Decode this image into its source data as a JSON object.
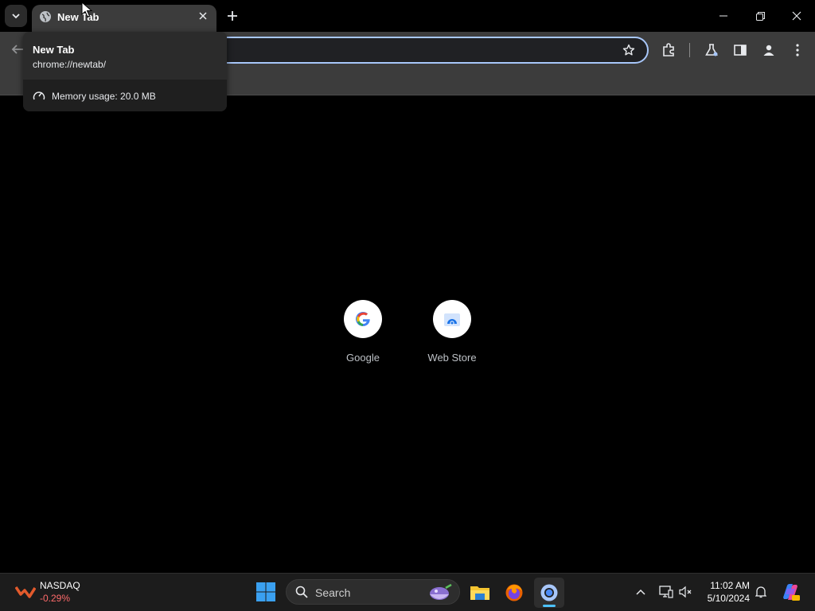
{
  "browser": {
    "tab": {
      "title": "New Tab",
      "favicon": "globe-icon"
    },
    "hovercard": {
      "title": "New Tab",
      "url": "chrome://newtab/",
      "memory": "Memory usage: 20.0 MB"
    },
    "omnibox": {
      "value": ""
    },
    "toolbar_icons": [
      "back-arrow-icon",
      "star-icon",
      "extensions-icon",
      "labs-flask-icon",
      "side-panel-icon",
      "profile-icon",
      "menu-dots-icon"
    ]
  },
  "newtab": {
    "shortcuts": [
      {
        "label": "Google",
        "icon": "google-g-icon"
      },
      {
        "label": "Web Store",
        "icon": "web-store-icon"
      }
    ]
  },
  "taskbar": {
    "widget": {
      "name": "NASDAQ",
      "change": "-0.29%",
      "change_color": "#ff6b6b"
    },
    "search_label": "Search",
    "apps": [
      "file-explorer-icon",
      "firefox-icon",
      "chrome-icon"
    ],
    "clock": {
      "time": "11:02 AM",
      "date": "5/10/2024"
    }
  },
  "colors": {
    "accent": "#a8c7fa",
    "taskbar_active": "#4cc2ff"
  }
}
